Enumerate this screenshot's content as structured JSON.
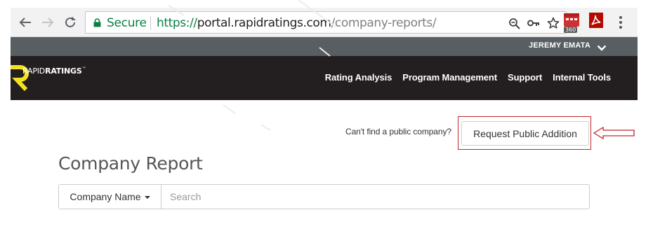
{
  "browser": {
    "security_label": "Secure",
    "url_scheme": "https://",
    "url_host": "portal.rapidratings.com",
    "url_path": "/company-reports/",
    "extension_badge": "360",
    "icons": [
      "back-arrow-icon",
      "forward-arrow-icon",
      "reload-icon",
      "lock-icon",
      "zoom-icon",
      "key-icon",
      "star-icon",
      "calendar-extension-icon",
      "pdf-extension-icon",
      "menu-dots-icon"
    ]
  },
  "header": {
    "user_name": "JEREMY EMATA",
    "logo_light": "RAPID",
    "logo_bold": "RATINGS",
    "logo_tm": "™",
    "nav": [
      "Rating Analysis",
      "Program Management",
      "Support",
      "Internal Tools"
    ]
  },
  "main": {
    "cant_find_text": "Can't find a public company?",
    "request_button_label": "Request Public Addition",
    "page_title": "Company Report",
    "filter_label": "Company Name",
    "search_placeholder": "Search"
  },
  "colors": {
    "secure_green": "#0b8043",
    "topbar_gray": "#585e61",
    "header_dark": "#231f20",
    "logo_yellow": "#f5e21e",
    "annotation_red": "#c0272d"
  }
}
